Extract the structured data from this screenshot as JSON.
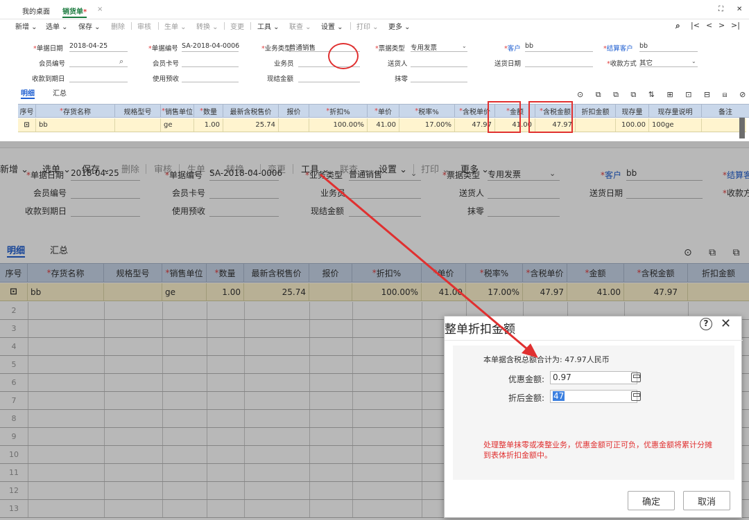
{
  "tabs": {
    "desktop": "我的桌面",
    "sales": "销货单",
    "sales_mark": "*",
    "close": "×"
  },
  "window_controls": {
    "restore": "⛶",
    "close": "✕"
  },
  "toolbar": [
    {
      "label": "新增 ⌄"
    },
    {
      "label": "选单 ⌄"
    },
    {
      "label": "保存 ⌄"
    },
    {
      "label": "删除"
    },
    {
      "label": "审核"
    },
    {
      "label": "生单 ⌄"
    },
    {
      "label": "转换 ⌄"
    },
    {
      "label": "变更"
    },
    {
      "label": "工具 ⌄"
    },
    {
      "label": "联查 ⌄"
    },
    {
      "label": "设置 ⌄"
    },
    {
      "label": "打印 ⌄"
    },
    {
      "label": "更多 ⌄"
    }
  ],
  "nav": {
    "search": "⌕",
    "first": "|<",
    "prev": "<",
    "next": ">",
    "last": ">|"
  },
  "form": {
    "date_label": "单据日期",
    "date_value": "2018-04-25",
    "code_label": "单据编号",
    "code_value": "SA-2018-04-0006",
    "biztype_label": "业务类型",
    "biztype_value": "普通销售",
    "invtype_label": "票据类型",
    "invtype_value": "专用发票",
    "customer_label": "客户",
    "customer_value": "bb",
    "settle_label": "结算客户",
    "settle_value": "bb",
    "member_label": "会员编号",
    "card_label": "会员卡号",
    "staff_label": "业务员",
    "deliver_label": "送货人",
    "deliverdate_label": "送货日期",
    "payment_label": "收款方式",
    "payment_value": "其它",
    "duedate_label": "收款到期日",
    "prepay_label": "使用预收",
    "cash_label": "现结金额",
    "rounding_label": "抹零"
  },
  "subtabs": {
    "detail": "明细",
    "summary": "汇总"
  },
  "toolicons": "⊙ ⧉ ⧉ ⧉ ⇅ ⊞ ⊡ ⊟ ⧈ ⊘ ⌂ ⛶",
  "table": {
    "headers": [
      "序号",
      "存货名称",
      "规格型号",
      "销售单位",
      "数量",
      "最新含税售价",
      "报价",
      "折扣%",
      "单价",
      "税率%",
      "含税单价",
      "金额",
      "含税金额",
      "折扣金额",
      "现存量",
      "现存量说明",
      "备注"
    ],
    "row": {
      "seq": "⊡",
      "name": "bb",
      "unit": "ge",
      "qty": "1.00",
      "last_price": "25.74",
      "discount": "100.00%",
      "price": "41.00",
      "tax": "17.00%",
      "tax_price": "47.97",
      "amount": "41.00",
      "tax_amount": "47.97",
      "stock": "100.00",
      "stock_note": "100ge"
    },
    "row_numbers": [
      "2",
      "3",
      "4",
      "5",
      "6",
      "7",
      "8",
      "9",
      "10",
      "11",
      "12",
      "13"
    ]
  },
  "dialog": {
    "title": "整单折扣金额",
    "help": "?",
    "close": "✕",
    "total_text": "本单据含税总额合计为: 47.97人民币",
    "discount_label": "优惠金额:",
    "discount_value": "0.97",
    "after_label": "折后金额:",
    "after_value": "47",
    "note": "处理整单抹零或凑整业务，优惠金额可正可负，优惠金额将累计分摊到表体折扣金额中。",
    "ok": "确定",
    "cancel": "取消"
  },
  "colors": {
    "accent_green": "#1a7a3e",
    "link_blue": "#1f5fd1",
    "header_blue": "#c9d7ea",
    "row_yellow": "#fff4cf",
    "annotation_red": "#e03030"
  }
}
